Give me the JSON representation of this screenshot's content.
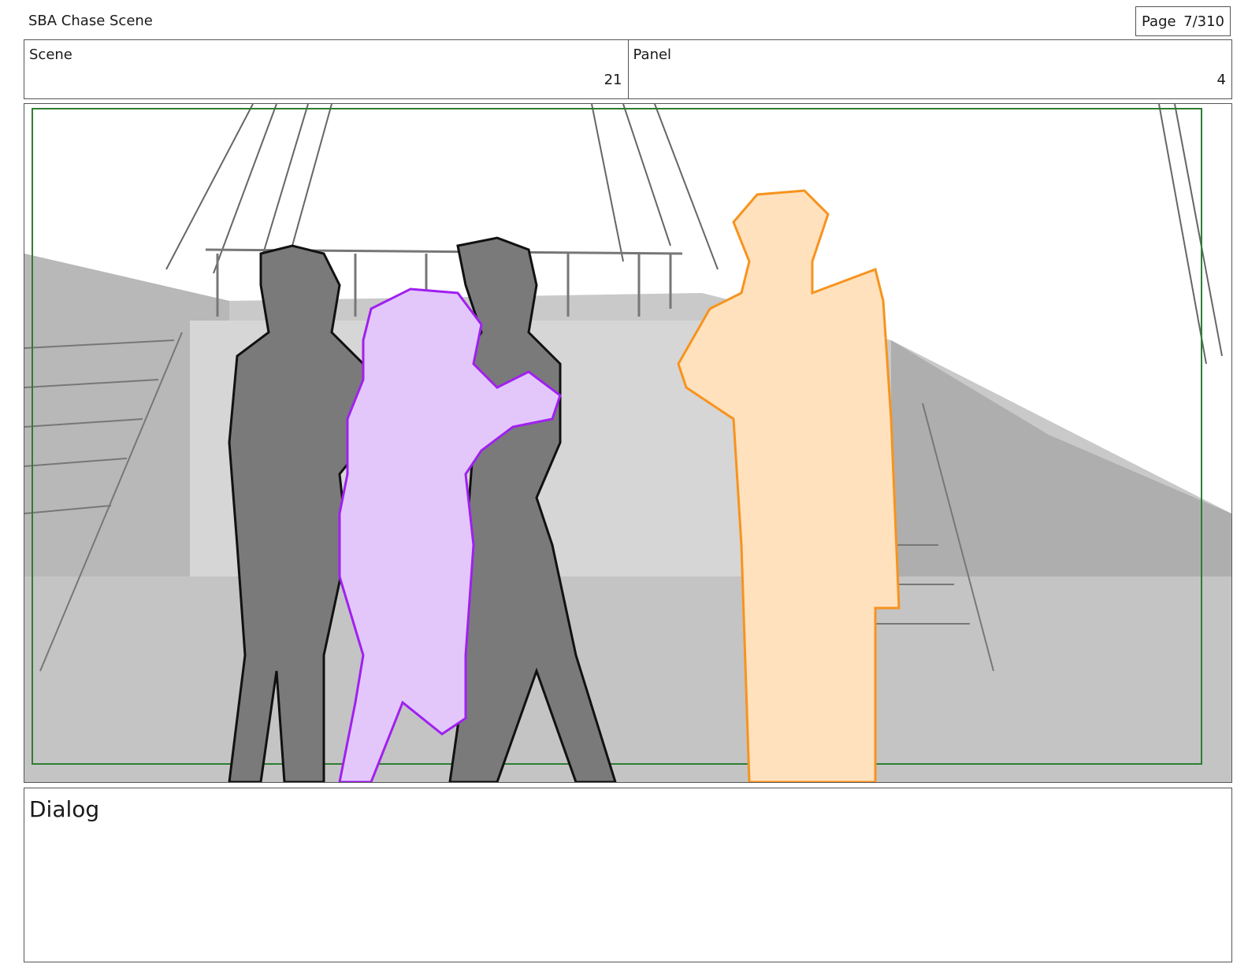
{
  "header": {
    "title": "SBA Chase Scene",
    "page_label": "Page",
    "page_value": "7/310"
  },
  "info": {
    "scene_label": "Scene",
    "scene_value": "21",
    "panel_label": "Panel",
    "panel_value": "4"
  },
  "panel": {
    "image_description_icon": "storyboard-sketch",
    "safe_frame_color": "#2e7d32",
    "character_colors": {
      "guards": "#7a7a7a",
      "captive": "#e3c7fb",
      "captive_line": "#a020f0",
      "observer": "#ffe1bd",
      "observer_line": "#f7931e"
    }
  },
  "dialog": {
    "label": "Dialog",
    "text": ""
  }
}
